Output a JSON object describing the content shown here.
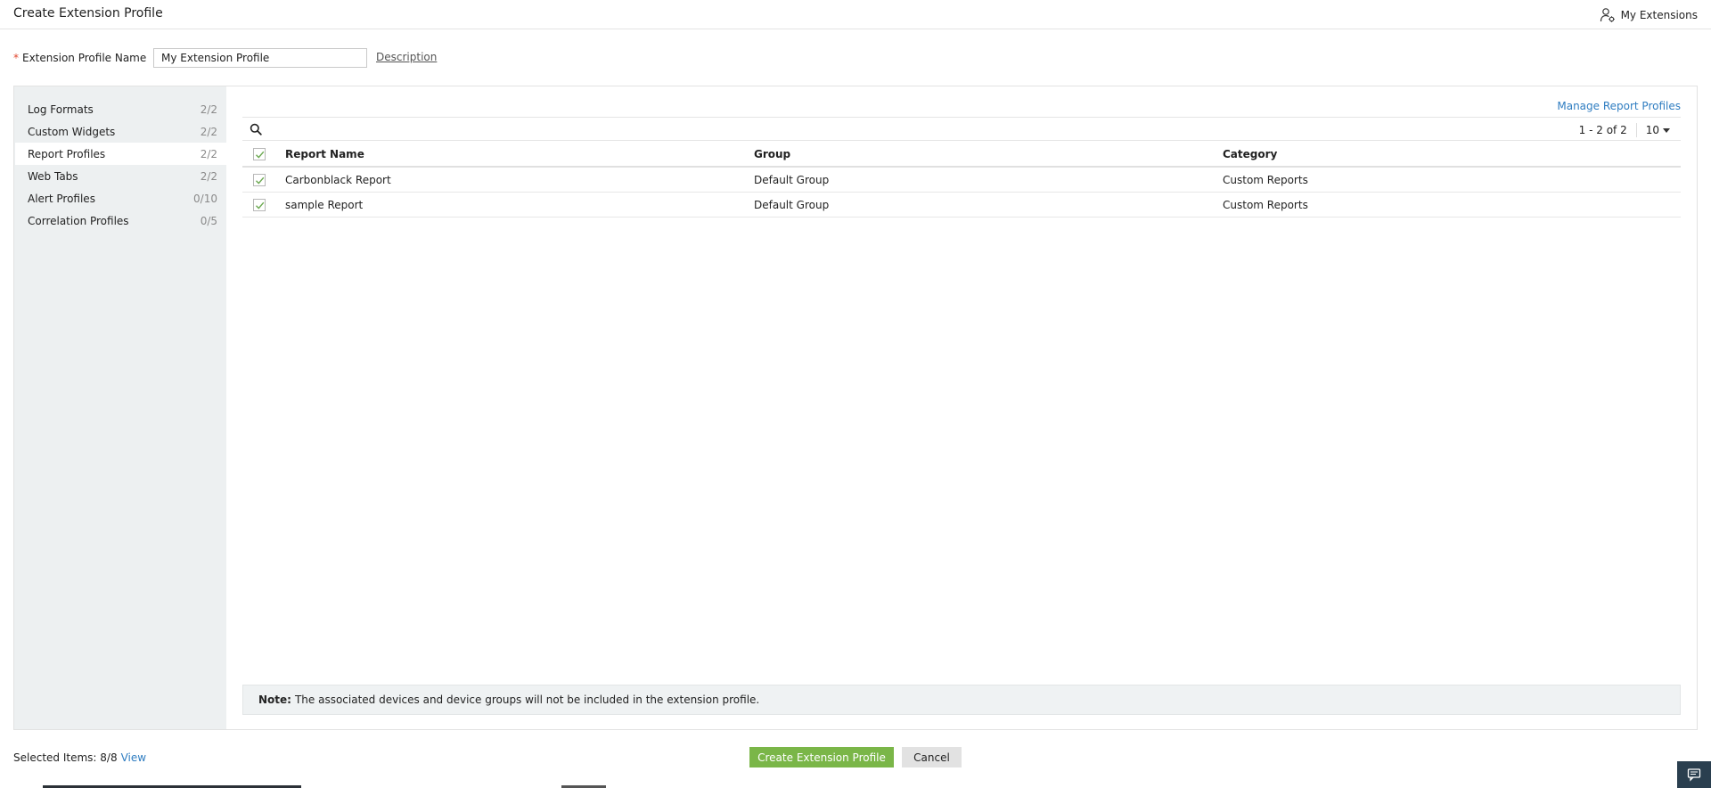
{
  "header": {
    "title": "Create Extension Profile",
    "my_extensions_label": "My Extensions"
  },
  "form": {
    "required_mark": "*",
    "name_label": "Extension Profile Name",
    "name_value": "My Extension Profile",
    "description_link": "Description"
  },
  "sidebar": {
    "items": [
      {
        "label": "Log Formats",
        "count": "2/2"
      },
      {
        "label": "Custom Widgets",
        "count": "2/2"
      },
      {
        "label": "Report Profiles",
        "count": "2/2",
        "active": true
      },
      {
        "label": "Web Tabs",
        "count": "2/2"
      },
      {
        "label": "Alert Profiles",
        "count": "0/10"
      },
      {
        "label": "Correlation Profiles",
        "count": "0/5"
      }
    ]
  },
  "main": {
    "manage_link": "Manage Report Profiles",
    "pagination": "1 - 2 of 2",
    "per_page": "10",
    "columns": [
      "Report Name",
      "Group",
      "Category"
    ],
    "rows": [
      {
        "name": "Carbonblack Report",
        "group": "Default Group",
        "category": "Custom Reports",
        "checked": true
      },
      {
        "name": "sample Report",
        "group": "Default Group",
        "category": "Custom Reports",
        "checked": true
      }
    ],
    "note_label": "Note:",
    "note_text": "The associated devices and device groups will not be included in the extension profile."
  },
  "footer": {
    "selected_label": "Selected Items: 8/8",
    "view_link": "View",
    "create_button": "Create Extension Profile",
    "cancel_button": "Cancel"
  },
  "colors": {
    "accent_green": "#7ab648",
    "link_blue": "#2f7dc1",
    "panel_bg": "#edf0f1"
  }
}
